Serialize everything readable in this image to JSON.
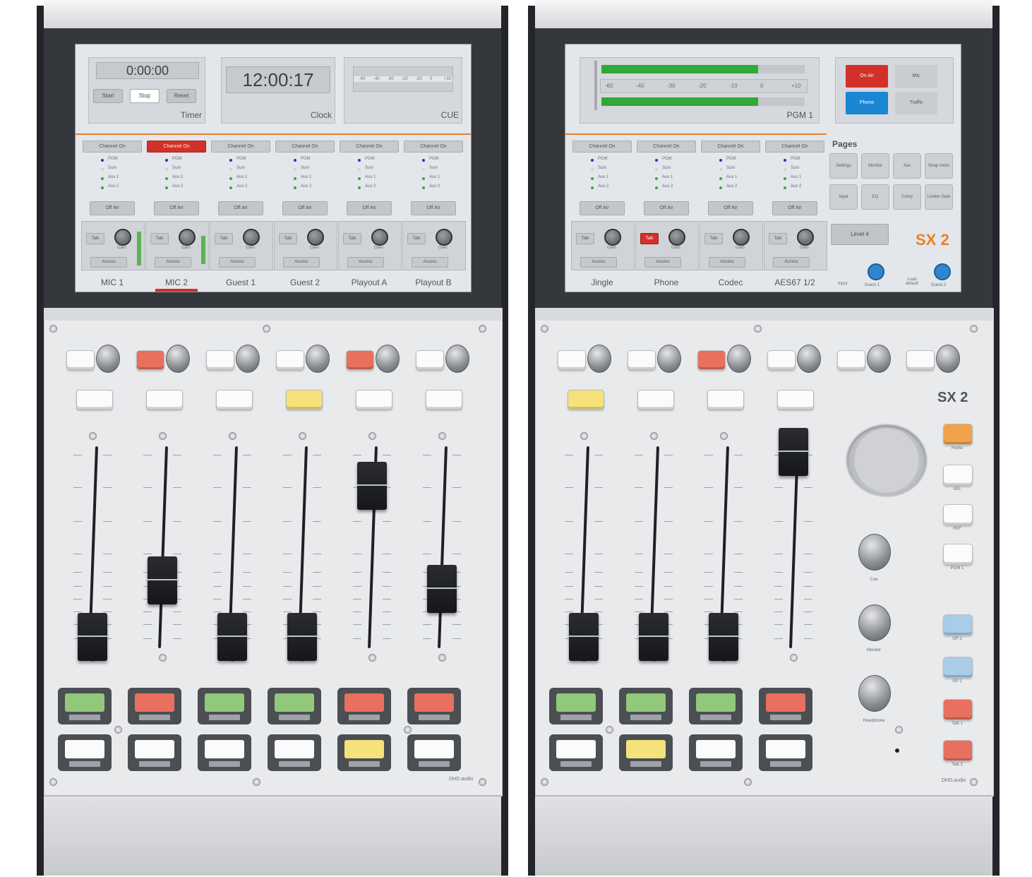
{
  "left_console": {
    "timer": {
      "value": "0:00:00",
      "start": "Start",
      "stop": "Stop",
      "reset": "Reset",
      "label": "Timer"
    },
    "clock": {
      "value": "12:00:17",
      "label": "Clock"
    },
    "cue": {
      "label": "CUE",
      "scale": [
        "-60",
        "-40",
        "-30",
        "-20",
        "-10",
        "0",
        "+10"
      ]
    },
    "channels": [
      {
        "header": "Channel On",
        "air": "Off Air",
        "name": "MIC 1",
        "active": false
      },
      {
        "header": "Channel On",
        "air": "Off Air",
        "name": "MIC 2",
        "active": true
      },
      {
        "header": "Channel On",
        "air": "Off Air",
        "name": "Guest 1",
        "active": false
      },
      {
        "header": "Channel On",
        "air": "Off Air",
        "name": "Guest 2",
        "active": false
      },
      {
        "header": "Channel On",
        "air": "Off Air",
        "name": "Playout A",
        "active": false
      },
      {
        "header": "Channel On",
        "air": "Off Air",
        "name": "Playout B",
        "active": false
      }
    ],
    "routing_labels": [
      "PGM",
      "Sum",
      "Aux 1",
      "Aux 2"
    ],
    "talk_label": "Talk",
    "gain_label": "Gain",
    "access_label": "Access",
    "brand": "DHD.audio"
  },
  "right_console": {
    "meter": {
      "label": "PGM 1",
      "scale": [
        "-60",
        "-40",
        "-30",
        "-20",
        "-10",
        "0",
        "+10"
      ]
    },
    "monitor": {
      "onair": "On Air",
      "phone": "Phone",
      "mic": "Mic",
      "traffic": "Traffic"
    },
    "channels": [
      {
        "header": "Channel On",
        "air": "Off Air",
        "name": "Jingle"
      },
      {
        "header": "Channel On",
        "air": "Off Air",
        "name": "Phone"
      },
      {
        "header": "Channel On",
        "air": "Off Air",
        "name": "Codec"
      },
      {
        "header": "Channel On",
        "air": "Off Air",
        "name": "AES67 1/2"
      }
    ],
    "pages_title": "Pages",
    "pages": [
      "Settings",
      "Monitor Select",
      "Aux",
      "Snap shots",
      "Input",
      "EQ",
      "Comp",
      "Limiter Gate"
    ],
    "level_btn": "Level 4",
    "logo": "SX 2",
    "front_logo": "SX 2",
    "footer": {
      "left": "Input",
      "mid": "Load default",
      "g1": "Guest 1",
      "g2": "Guest 2"
    },
    "knob_labels": [
      "Cue",
      "Monitor",
      "Headphone"
    ],
    "right_keys": [
      "Home",
      "SEL",
      "REF",
      "PGM 1",
      "GP 2",
      "GP 1",
      "Talk 1",
      "Talk 2"
    ],
    "brand": "DHD.audio"
  },
  "colors": {
    "onair_red": "#d2312a",
    "phone_blue": "#1b86d1",
    "sx2_orange": "#e8822b",
    "meter_green": "#30a83a"
  }
}
